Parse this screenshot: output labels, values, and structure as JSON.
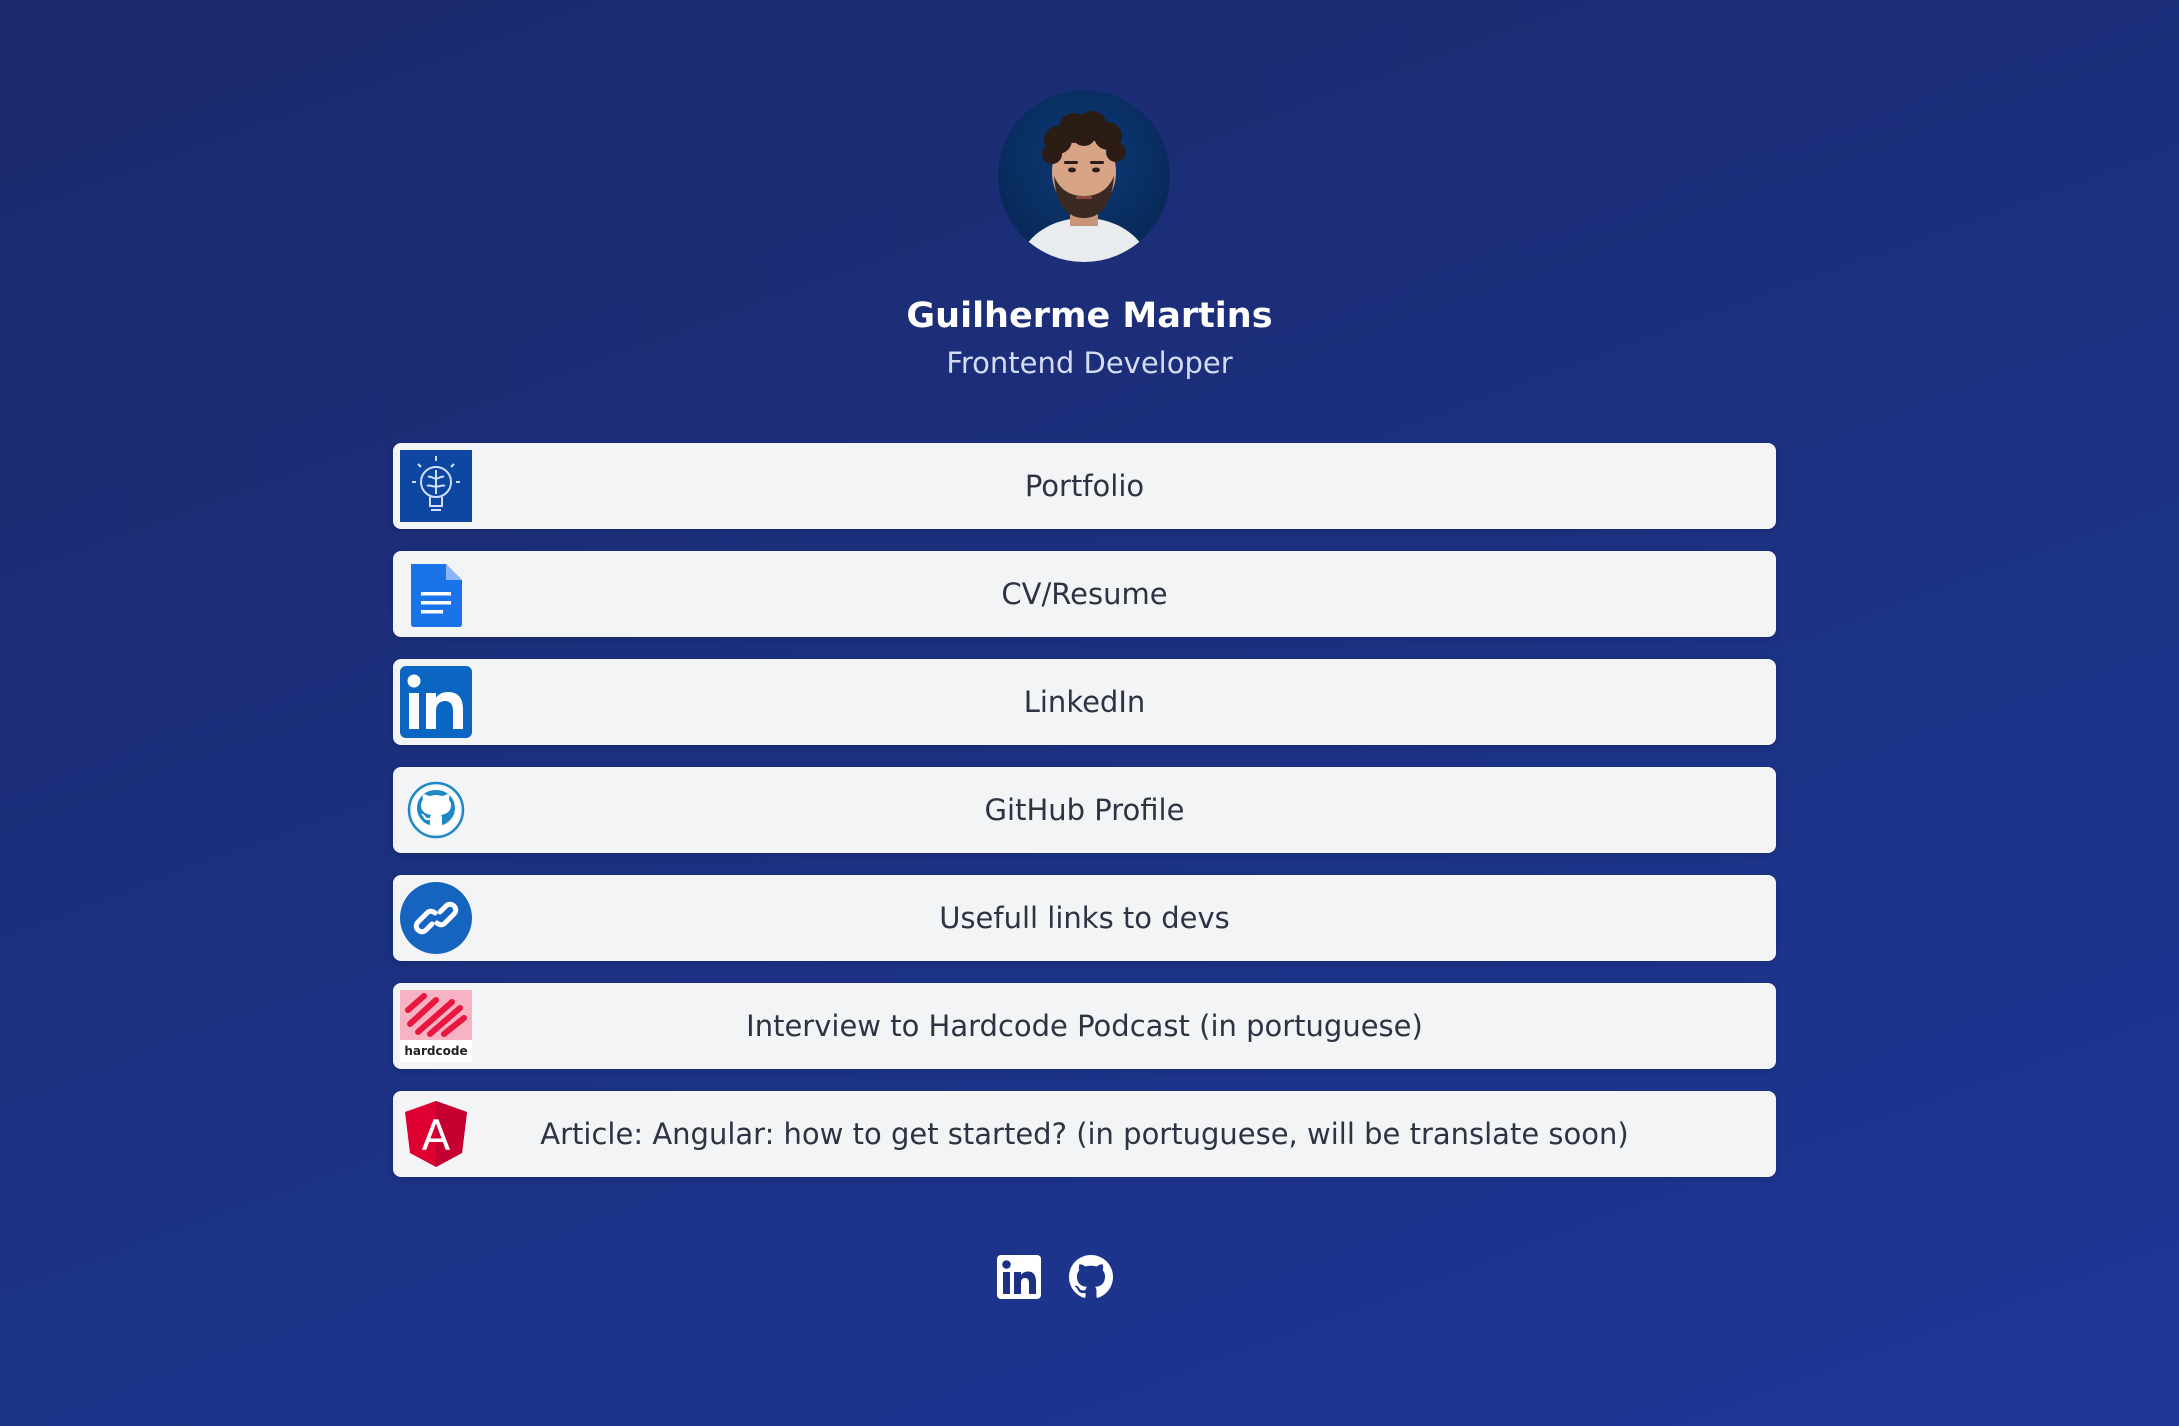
{
  "profile": {
    "name": "Guilherme Martins",
    "role": "Frontend Developer"
  },
  "links": [
    {
      "label": "Portfolio",
      "icon": "lightbulb-brain-icon"
    },
    {
      "label": "CV/Resume",
      "icon": "document-icon"
    },
    {
      "label": "LinkedIn",
      "icon": "linkedin-icon"
    },
    {
      "label": "GitHub Profile",
      "icon": "github-icon"
    },
    {
      "label": "Usefull links to devs",
      "icon": "link-icon"
    },
    {
      "label": "Interview to Hardcode Podcast (in portuguese)",
      "icon": "hardcode-logo-icon",
      "logo_text": "hardcode"
    },
    {
      "label": "Article: Angular: how to get started? (in portuguese, will be translate soon)",
      "icon": "angular-icon",
      "logo_text": "A"
    }
  ],
  "footer": {
    "icons": [
      "linkedin-icon",
      "github-icon"
    ]
  },
  "colors": {
    "background": "#1c3183",
    "card": "#f3f4f6",
    "text": "#2d3342",
    "linkedin": "#0a66c2",
    "docs": "#1a73e8",
    "angular": "#dd0031"
  }
}
